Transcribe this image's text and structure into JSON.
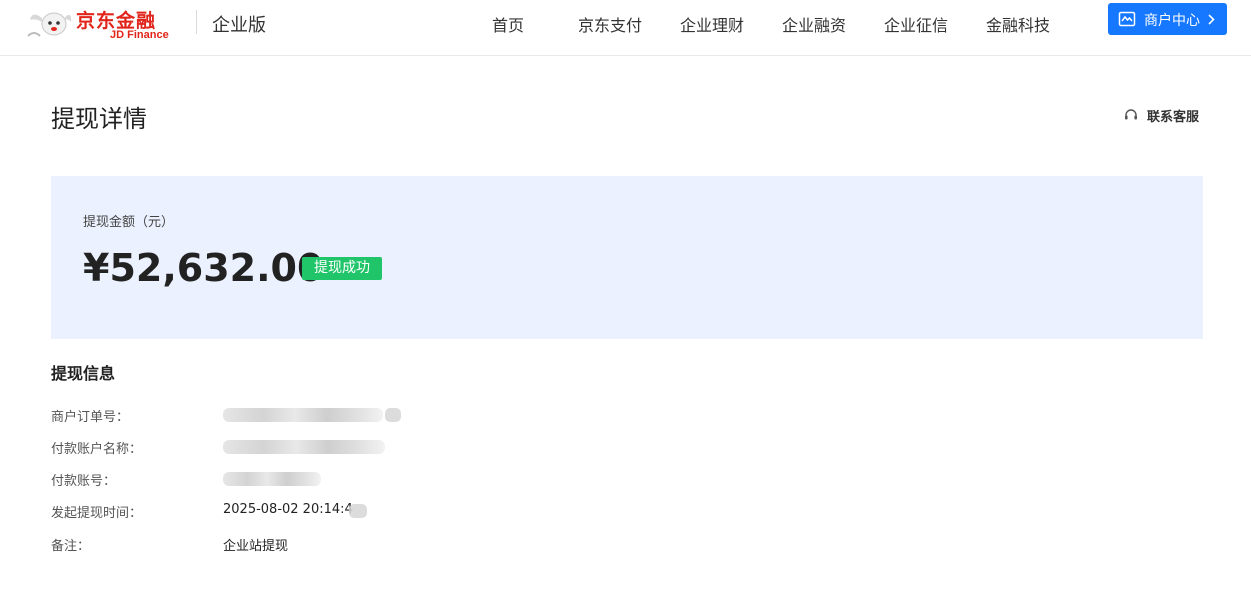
{
  "header": {
    "logo_cn": "京东金融",
    "logo_en": "JD Finance",
    "edition": "企业版",
    "nav": [
      "首页",
      "京东支付",
      "企业理财",
      "企业融资",
      "企业征信",
      "金融科技"
    ],
    "merchant_center": "商户中心"
  },
  "page": {
    "title": "提现详情",
    "support": "联系客服"
  },
  "amount": {
    "label": "提现金额（元）",
    "value": "¥52,632.00",
    "status": "提现成功"
  },
  "info": {
    "section_title": "提现信息",
    "rows": [
      {
        "label": "商户订单号：",
        "value": ""
      },
      {
        "label": "付款账户名称：",
        "value": ""
      },
      {
        "label": "付款账号：",
        "value": ""
      },
      {
        "label": "发起提现时间：",
        "value": "2025-08-02 20:14:4"
      },
      {
        "label": "备注：",
        "value": "企业站提现"
      }
    ]
  },
  "colors": {
    "brand_red": "#e1251b",
    "primary_blue": "#1677ff",
    "card_bg": "#ebf1fe",
    "success_green": "#20c56a"
  },
  "icons": [
    "jd-dog-logo-icon",
    "storefront-icon",
    "chevron-right-icon",
    "headset-icon"
  ]
}
